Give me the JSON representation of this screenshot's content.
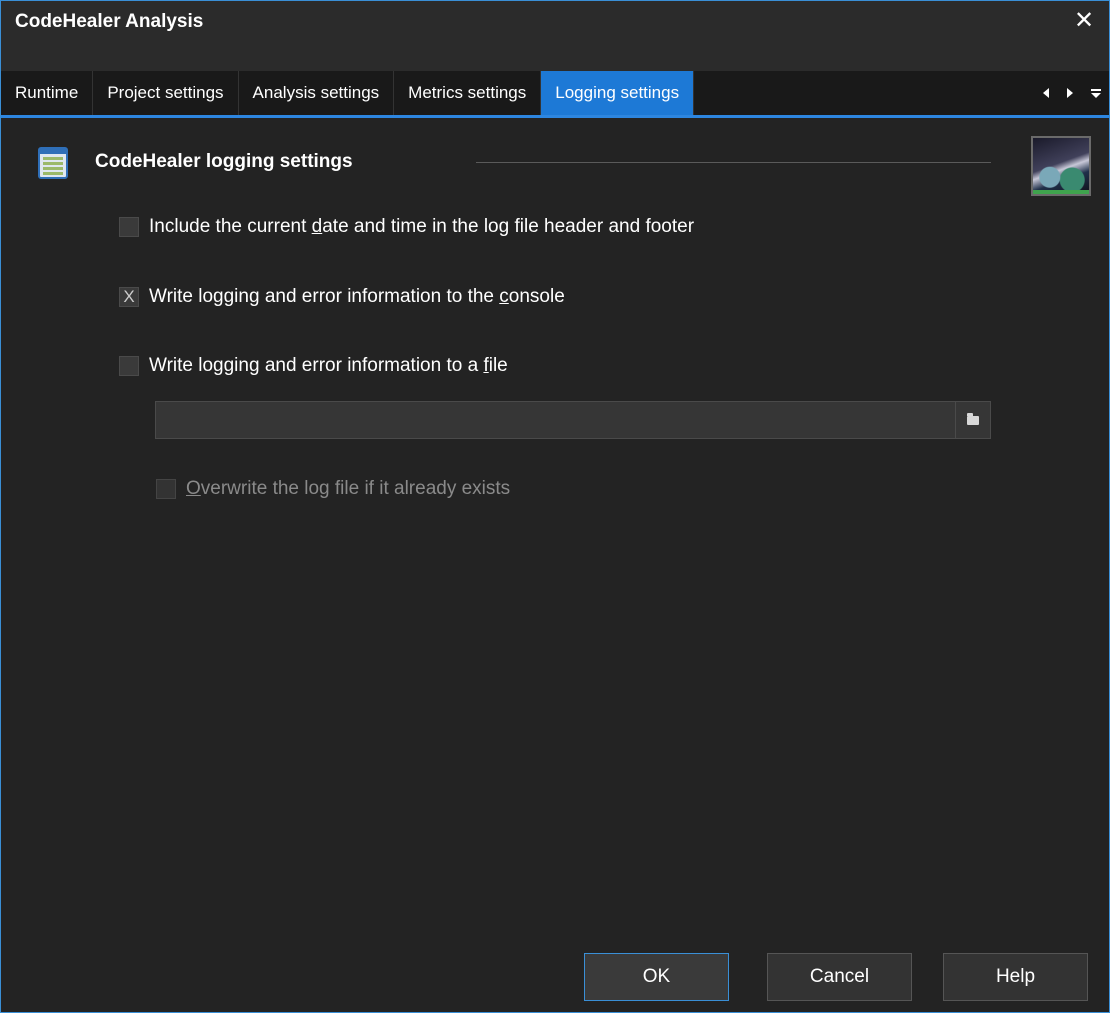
{
  "window": {
    "title": "CodeHealer Analysis",
    "close_glyph": "✕"
  },
  "tabs": [
    {
      "label": "Runtime",
      "active": false
    },
    {
      "label": "Project settings",
      "active": false
    },
    {
      "label": "Analysis settings",
      "active": false
    },
    {
      "label": "Metrics settings",
      "active": false
    },
    {
      "label": "Logging settings",
      "active": true
    }
  ],
  "tab_nav": {
    "icons": [
      "scroll-left-icon",
      "scroll-right-icon",
      "tab-menu-icon"
    ]
  },
  "section": {
    "title": "CodeHealer logging settings",
    "icon": "settings-sheet-icon",
    "logo_icon": "codehealer-logo-icon"
  },
  "options": {
    "include_datetime": {
      "label_pre": "Include the current ",
      "label_mnemonic": "d",
      "label_post": "ate and time in the log file header and footer",
      "checked": false
    },
    "log_console": {
      "label_pre": "Write logging and error information to the ",
      "label_mnemonic": "c",
      "label_post": "onsole",
      "checked": true,
      "check_glyph": "X"
    },
    "log_file": {
      "label_pre": "Write logging and error information to a ",
      "label_mnemonic": "f",
      "label_post": "ile",
      "checked": false
    },
    "log_file_path": {
      "value": "",
      "placeholder": "",
      "browse_icon": "folder-open-icon"
    },
    "overwrite": {
      "label_mnemonic": "O",
      "label_post": "verwrite the log file if it already exists",
      "checked": false,
      "enabled": false
    }
  },
  "buttons": {
    "ok": "OK",
    "cancel": "Cancel",
    "help": "Help"
  },
  "colors": {
    "accent": "#1d79d6",
    "background": "#232323",
    "text": "#ffffff"
  }
}
